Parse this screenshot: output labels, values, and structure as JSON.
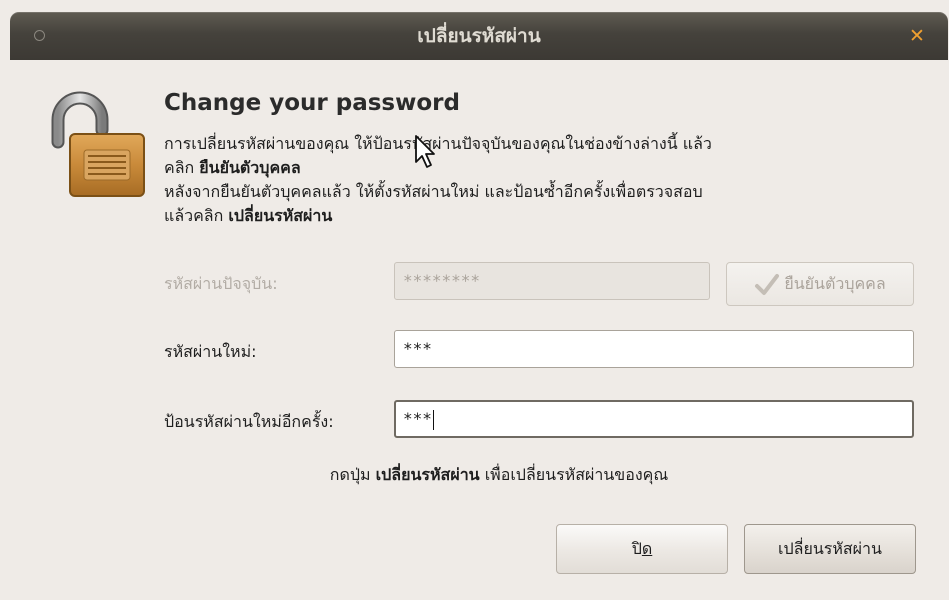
{
  "window": {
    "title": "เปลี่ยนรหัสผ่าน",
    "close_glyph": "✕"
  },
  "header": {
    "heading": "Change your password",
    "desc_line1": "การเปลี่ยนรหัสผ่านของคุณ ให้ป้อนรหัสผ่านปัจจุบันของคุณในช่องข้างล่างนี้ แล้ว",
    "desc_line2_prefix": "คลิก ",
    "desc_line2_bold": "ยืนยันตัวบุคคล",
    "desc_line3": "หลังจากยืนยันตัวบุคคลแล้ว ให้ตั้งรหัสผ่านใหม่ และป้อนซ้ำอีกครั้งเพื่อตรวจสอบ",
    "desc_line4_prefix": "แล้วคลิก ",
    "desc_line4_bold": "เปลี่ยนรหัสผ่าน"
  },
  "form": {
    "current_label": "รหัสผ่านปัจจุบัน:",
    "current_value": "********",
    "authenticate_label": "ยืนยันตัวบุคคล",
    "new_label": "รหัสผ่านใหม่:",
    "new_value": "***",
    "retype_label": "ป้อนรหัสผ่านใหม่อีกครั้ง:",
    "retype_value": "***"
  },
  "hint": {
    "prefix": "กดปุ่ม ",
    "bold": "เปลี่ยนรหัสผ่าน",
    "suffix": " เพื่อเปลี่ยนรหัสผ่านของคุณ"
  },
  "buttons": {
    "close_label_main": "ปิ",
    "close_label_mnemonic": "ด",
    "change_label": "เปลี่ยนรหัสผ่าน"
  },
  "icons": {
    "lock": "lock-open-icon",
    "check": "check-icon",
    "pointer": "mouse-pointer-icon"
  },
  "colors": {
    "titlebar": "#3c3934",
    "close_accent": "#f0a030",
    "lock_body": "#c98a3a"
  }
}
